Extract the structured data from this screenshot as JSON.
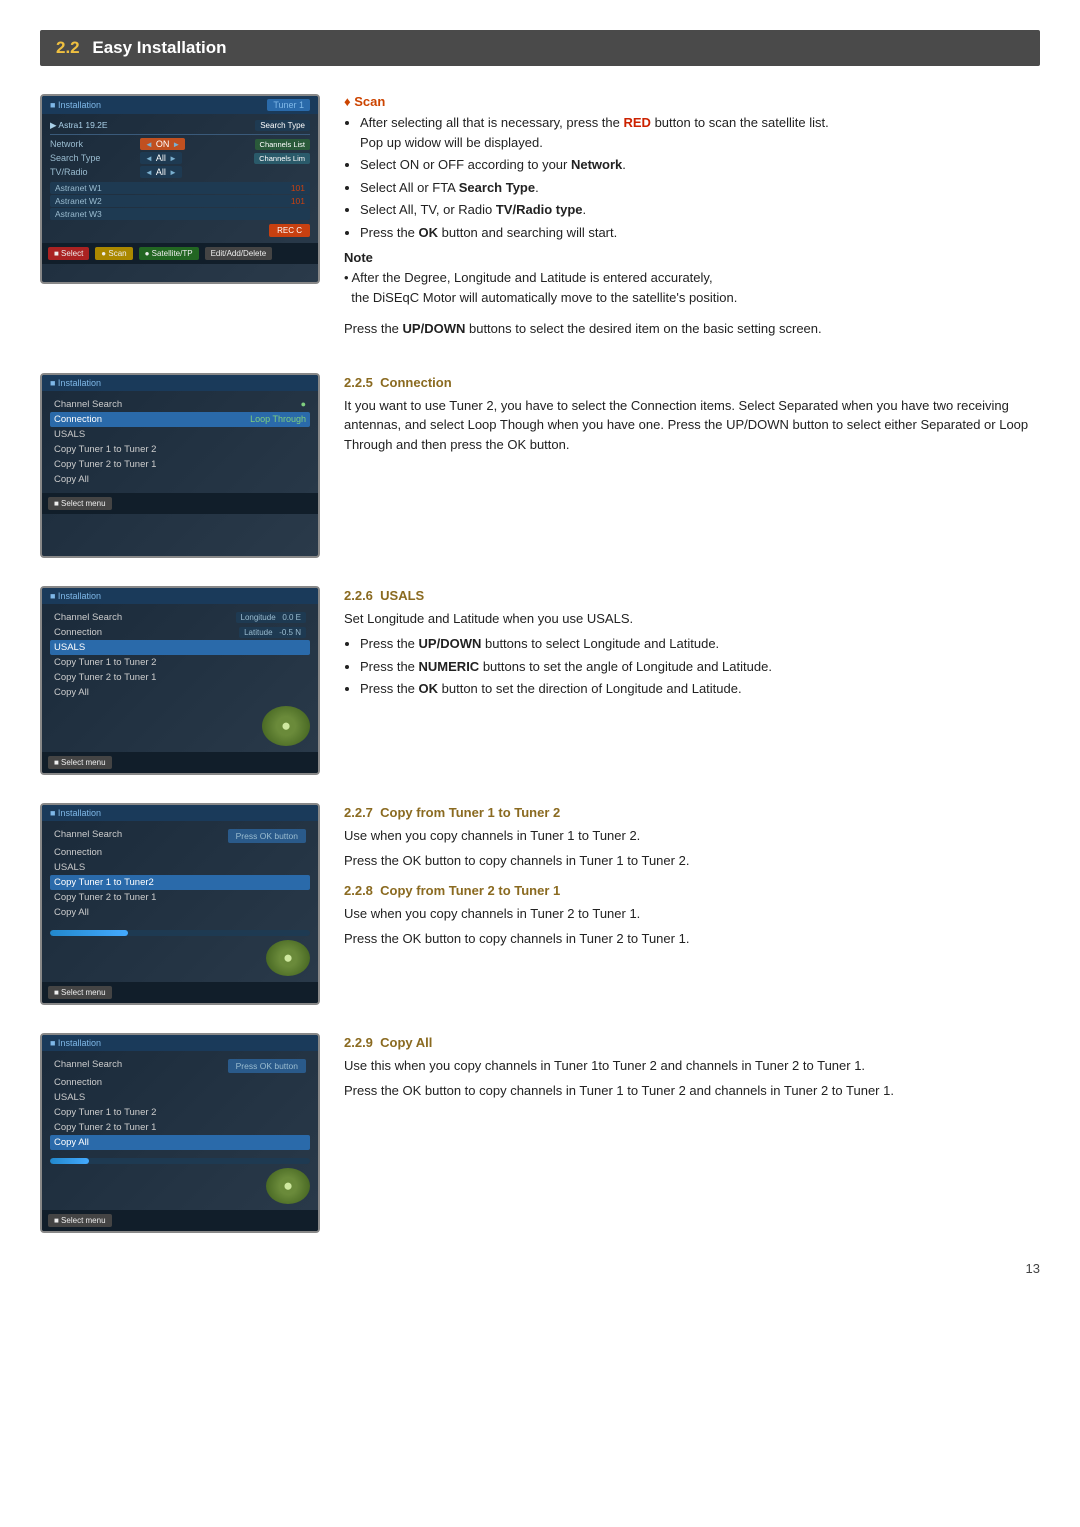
{
  "section": {
    "number": "2.2",
    "title": "Easy Installation",
    "number_color": "#f0c040"
  },
  "scan_section": {
    "topic": "Scan",
    "bullets": [
      "After selecting all that is necessary, press the RED button to scan the satellite list. Pop up widow will be displayed.",
      "Select ON or OFF according to your Network.",
      "Select All or FTA Search Type.",
      "Select All, TV, or Radio TV/Radio type.",
      "Press the OK button and searching will start."
    ],
    "note_label": "Note",
    "note_text": "After the Degree, Longitude and Latitude is entered accurately, the DiSEqC Motor will automatically move to the satellite's position.",
    "press_text": "Press the UP/DOWN buttons to select the desired item on the basic setting screen."
  },
  "subsection_225": {
    "id": "2.2.5",
    "title": "Connection",
    "body": "It you want to use Tuner 2, you have to select the Connection items. Select Separated when you have two receiving antennas, and select Loop Though when you have one. Press the UP/DOWN button to select either Separated or Loop Through and then press the OK button."
  },
  "subsection_226": {
    "id": "2.2.6",
    "title": "USALS",
    "intro": "Set Longitude and Latitude when you use USALS.",
    "bullets": [
      "Press the UP/DOWN buttons to select Longitude and Latitude.",
      "Press the NUMERIC buttons to set the angle of Longitude and Latitude.",
      "Press the OK button to set the direction of Longitude and Latitude."
    ]
  },
  "subsection_227": {
    "id": "2.2.7",
    "title": "Copy from Tuner 1 to Tuner 2",
    "line1": "Use when you copy channels in Tuner 1 to Tuner 2.",
    "line2": "Press the OK button to copy channels in Tuner 1 to Tuner 2."
  },
  "subsection_228": {
    "id": "2.2.8",
    "title": "Copy from Tuner 2 to Tuner 1",
    "line1": "Use when you copy channels in Tuner 2 to Tuner 1.",
    "line2": "Press the OK button to copy channels in Tuner 2 to Tuner 1."
  },
  "subsection_229": {
    "id": "2.2.9",
    "title": "Copy All",
    "line1": "Use this when you copy channels in Tuner 1to Tuner 2 and channels in Tuner 2 to Tuner 1.",
    "line2": "Press the OK button to copy channels in Tuner 1 to Tuner 2 and channels in Tuner 2 to Tuner 1."
  },
  "page_number": "13",
  "screens": {
    "screen1": {
      "title": "Installation",
      "tab": "Tuner 1"
    },
    "screen2": {
      "title": "Installation",
      "menu": [
        "Channel Search",
        "Connection",
        "USALS",
        "Copy Tuner 1 to Tuner 2",
        "Copy Tuner 2 to Tuner 1",
        "Copy All"
      ]
    },
    "screen3": {
      "title": "Installation",
      "usals_fields": [
        "Longitude: 0.0 E",
        "Latitude: -0.5 N"
      ]
    },
    "screen4": {
      "title": "Installation",
      "highlighted": "Copy Tuner 1 to Tuner 2",
      "ok_label": "Press OK button"
    },
    "screen5": {
      "title": "Installation",
      "highlighted": "Copy All",
      "ok_label": "Press OK button"
    }
  }
}
